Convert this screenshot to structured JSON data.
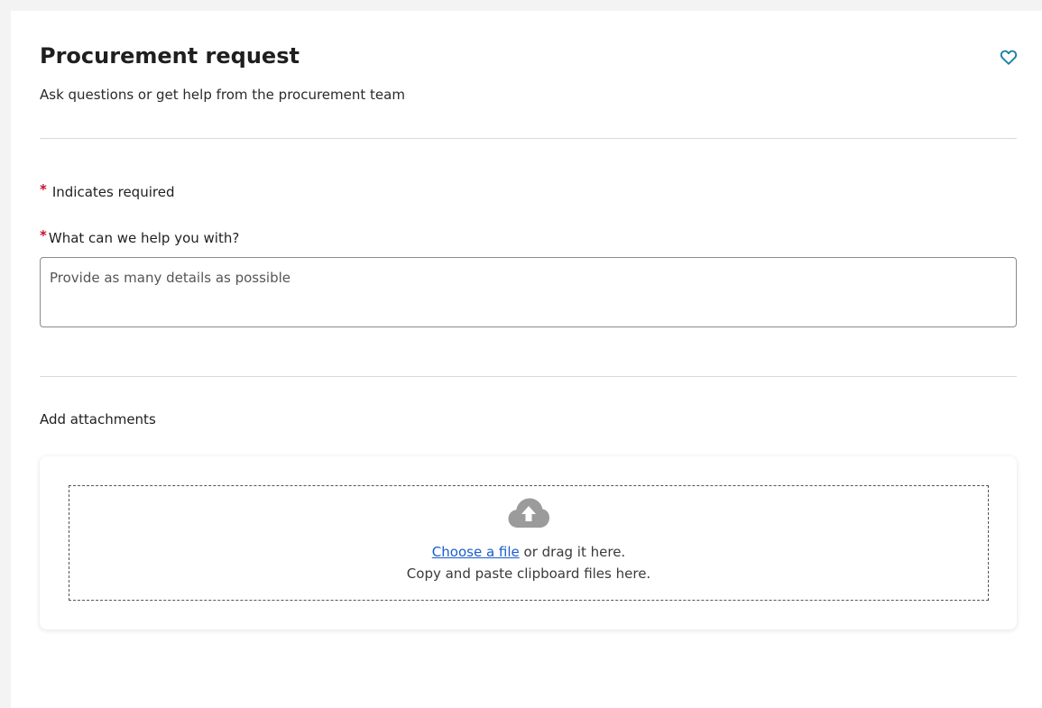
{
  "form": {
    "title": "Procurement request",
    "subtitle": "Ask questions or get help from the procurement team",
    "favorite_icon": "heart-outline-icon",
    "required_star": "*",
    "required_note": "Indicates required",
    "question_label": "What can we help you with?",
    "question_placeholder": "Provide as many details as possible",
    "question_value": ""
  },
  "attachments": {
    "label": "Add attachments",
    "upload_icon": "cloud-upload-icon",
    "choose_link": "Choose a file",
    "drag_text": " or drag it here.",
    "paste_text": "Copy and paste clipboard files here."
  },
  "colors": {
    "accent": "#1a5dcc",
    "heart": "#1b7ea8",
    "required": "#c8102e",
    "cloud": "#9b9b9b"
  }
}
